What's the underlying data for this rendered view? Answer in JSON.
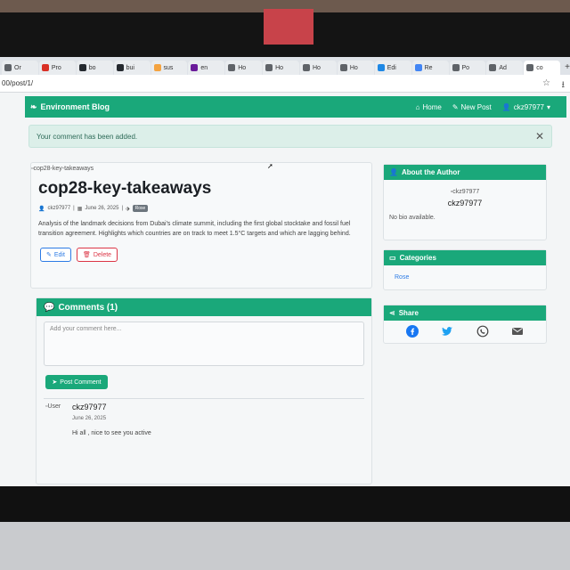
{
  "browser": {
    "tabs": [
      {
        "label": "Or",
        "color": "#5f6368"
      },
      {
        "label": "Pro",
        "color": "#d93025"
      },
      {
        "label": "bo",
        "color": "#24292f"
      },
      {
        "label": "bui",
        "color": "#24292f"
      },
      {
        "label": "sus",
        "color": "#f4a340"
      },
      {
        "label": "en",
        "color": "#6a1b9a"
      },
      {
        "label": "Ho",
        "color": "#5f6368"
      },
      {
        "label": "Ho",
        "color": "#5f6368"
      },
      {
        "label": "Ho",
        "color": "#5f6368"
      },
      {
        "label": "Ho",
        "color": "#5f6368"
      },
      {
        "label": "Edi",
        "color": "#1e88e5"
      },
      {
        "label": "Re",
        "color": "#4285f4"
      },
      {
        "label": "Po",
        "color": "#5f6368"
      },
      {
        "label": "Ad",
        "color": "#5f6368"
      },
      {
        "label": "co",
        "color": "#5f6368"
      }
    ],
    "url": "00/post/1/"
  },
  "navbar": {
    "brand": "Environment Blog",
    "home": "Home",
    "new_post": "New Post",
    "user": "ckz97977"
  },
  "alert": {
    "message": "Your comment has been added."
  },
  "post": {
    "image_alt": "cop28-key-takeaways",
    "title": "cop28-key-takeaways",
    "author": "ckz97977",
    "date": "June 26, 2025",
    "tag": "Rose",
    "description": "Analysis of the landmark decisions from Dubai's climate summit, including the first global stocktake and fossil fuel transition agreement. Highlights which countries are on track to meet 1.5°C targets and which are lagging behind.",
    "edit_label": "Edit",
    "delete_label": "Delete"
  },
  "comments": {
    "header": "Comments (1)",
    "placeholder": "Add your comment here...",
    "post_button": "Post Comment",
    "items": [
      {
        "avatar_alt": "User",
        "user": "ckz97977",
        "date": "June 26, 2025",
        "text": "Hi all , nice to see you active"
      }
    ]
  },
  "sidebar": {
    "about_title": "About the Author",
    "avatar_alt": "ckz97977",
    "author_name": "ckz97977",
    "bio": "No bio available.",
    "categories_title": "Categories",
    "category": "Rose",
    "share_title": "Share",
    "share_icons": [
      "facebook-icon",
      "twitter-icon",
      "whatsapp-icon",
      "email-icon"
    ]
  },
  "colors": {
    "brand_green": "#1aa87a",
    "link_blue": "#2c7be5",
    "danger_red": "#dc3545"
  }
}
